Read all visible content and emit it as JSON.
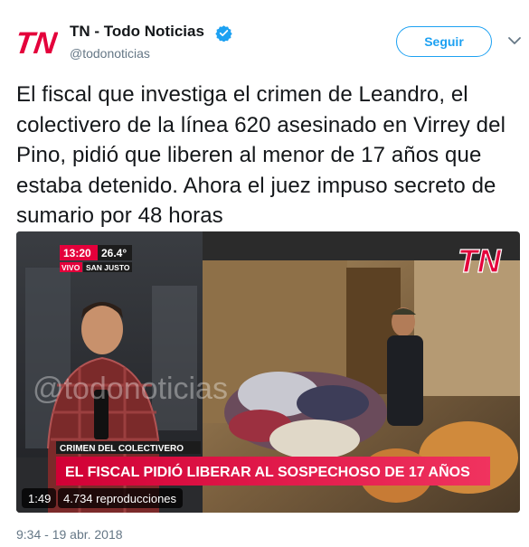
{
  "author": {
    "name": "TN - Todo Noticias",
    "handle": "@todonoticias",
    "avatar_text": "TN"
  },
  "follow_label": "Seguir",
  "tweet": {
    "text": "El fiscal que investiga el crimen de Leandro, el colectivero de la línea 620 asesinado en Virrey del Pino, pidió que liberen al menor de 17 años que estaba detenido. Ahora el juez impuso secreto de sumario por 48 horas",
    "timestamp": "9:34 - 19 abr. 2018"
  },
  "video": {
    "clock": "13:20",
    "temperature": "26.4°",
    "live_label": "VIVO",
    "location_label": "SAN JUSTO",
    "section_label": "CRIMEN DEL COLECTIVERO",
    "headline": "EL FISCAL PIDIÓ LIBERAR AL SOSPECHOSO DE 17 AÑOS",
    "watermark": "@todonoticias",
    "channel_logo": "TN",
    "duration": "1:49",
    "views": "4.734 reproducciones"
  },
  "colors": {
    "brand_red": "#e4003b",
    "twitter_blue": "#1da1f2",
    "verified": "#1da1f2",
    "secondary_text": "#657786"
  }
}
